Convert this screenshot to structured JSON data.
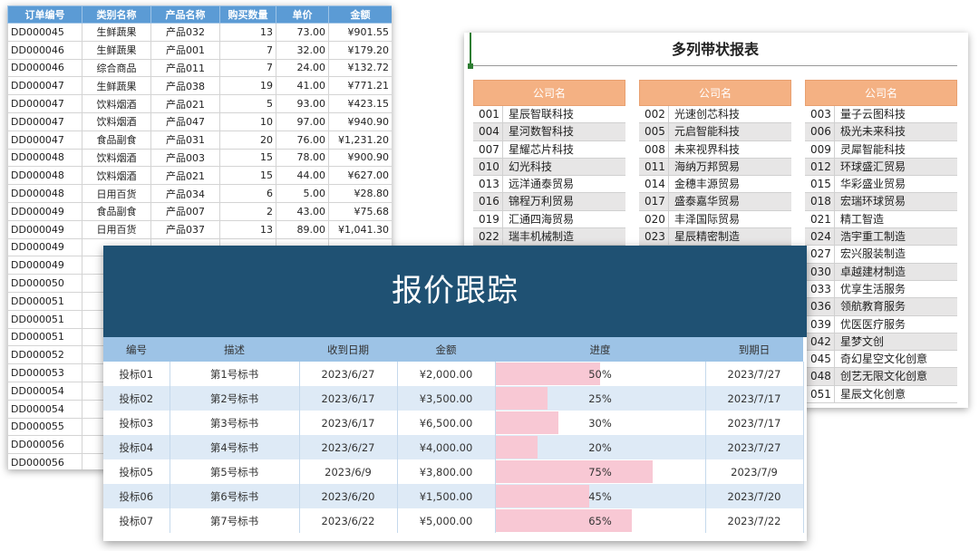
{
  "orders_sheet": {
    "headers": [
      "订单编号",
      "类别名称",
      "产品名称",
      "购买数量",
      "单价",
      "金额"
    ],
    "rows": [
      [
        "DD000045",
        "生鲜蔬果",
        "产品032",
        "13",
        "73.00",
        "¥901.55"
      ],
      [
        "DD000046",
        "生鲜蔬果",
        "产品001",
        "7",
        "32.00",
        "¥179.20"
      ],
      [
        "DD000046",
        "综合商品",
        "产品011",
        "7",
        "24.00",
        "¥132.72"
      ],
      [
        "DD000047",
        "生鲜蔬果",
        "产品038",
        "19",
        "41.00",
        "¥771.21"
      ],
      [
        "DD000047",
        "饮料烟酒",
        "产品021",
        "5",
        "93.00",
        "¥423.15"
      ],
      [
        "DD000047",
        "饮料烟酒",
        "产品047",
        "10",
        "97.00",
        "¥940.90"
      ],
      [
        "DD000047",
        "食品副食",
        "产品031",
        "20",
        "76.00",
        "¥1,231.20"
      ],
      [
        "DD000048",
        "饮料烟酒",
        "产品003",
        "15",
        "78.00",
        "¥900.90"
      ],
      [
        "DD000048",
        "饮料烟酒",
        "产品021",
        "15",
        "44.00",
        "¥627.00"
      ],
      [
        "DD000048",
        "日用百货",
        "产品034",
        "6",
        "5.00",
        "¥28.80"
      ],
      [
        "DD000049",
        "食品副食",
        "产品007",
        "2",
        "43.00",
        "¥75.68"
      ],
      [
        "DD000049",
        "日用百货",
        "产品037",
        "13",
        "89.00",
        "¥1,041.30"
      ],
      [
        "DD000049",
        "",
        "",
        "",
        "",
        ""
      ],
      [
        "DD000049",
        "",
        "",
        "",
        "",
        ""
      ],
      [
        "DD000050",
        "",
        "",
        "",
        "",
        ""
      ],
      [
        "DD000051",
        "",
        "",
        "",
        "",
        ""
      ],
      [
        "DD000051",
        "",
        "",
        "",
        "",
        ""
      ],
      [
        "DD000051",
        "",
        "",
        "",
        "",
        ""
      ],
      [
        "DD000052",
        "",
        "",
        "",
        "",
        ""
      ],
      [
        "DD000053",
        "",
        "",
        "",
        "",
        ""
      ],
      [
        "DD000054",
        "",
        "",
        "",
        "",
        ""
      ],
      [
        "DD000054",
        "",
        "",
        "",
        "",
        ""
      ],
      [
        "DD000055",
        "",
        "",
        "",
        "",
        ""
      ],
      [
        "DD000056",
        "",
        "",
        "",
        "",
        ""
      ],
      [
        "DD000056",
        "",
        "",
        "",
        "",
        ""
      ]
    ]
  },
  "banded_sheet": {
    "title": "多列带状报表",
    "column_header": "公司名",
    "columns": [
      [
        [
          "001",
          "星辰智联科技"
        ],
        [
          "004",
          "星河数智科技"
        ],
        [
          "007",
          "星耀芯片科技"
        ],
        [
          "010",
          "幻光科技"
        ],
        [
          "013",
          "远洋通泰贸易"
        ],
        [
          "016",
          "锦程万利贸易"
        ],
        [
          "019",
          "汇通四海贸易"
        ],
        [
          "022",
          "瑞丰机械制造"
        ]
      ],
      [
        [
          "002",
          "光速创芯科技"
        ],
        [
          "005",
          "元启智能科技"
        ],
        [
          "008",
          "未来视界科技"
        ],
        [
          "011",
          "海纳万邦贸易"
        ],
        [
          "014",
          "金穗丰源贸易"
        ],
        [
          "017",
          "盛泰嘉华贸易"
        ],
        [
          "020",
          "丰泽国际贸易"
        ],
        [
          "023",
          "星辰精密制造"
        ]
      ],
      [
        [
          "003",
          "量子云图科技"
        ],
        [
          "006",
          "极光未来科技"
        ],
        [
          "009",
          "灵犀智能科技"
        ],
        [
          "012",
          "环球盛汇贸易"
        ],
        [
          "015",
          "华彩盛业贸易"
        ],
        [
          "018",
          "宏瑞环球贸易"
        ],
        [
          "021",
          "精工智造"
        ],
        [
          "024",
          "浩宇重工制造"
        ],
        [
          "027",
          "宏兴服装制造"
        ],
        [
          "030",
          "卓越建材制造"
        ],
        [
          "033",
          "优享生活服务"
        ],
        [
          "036",
          "领航教育服务"
        ],
        [
          "039",
          "优医医疗服务"
        ],
        [
          "042",
          "星梦文创"
        ],
        [
          "045",
          "奇幻星空文化创意"
        ],
        [
          "048",
          "创艺无限文化创意"
        ],
        [
          "051",
          "星辰文化创意"
        ]
      ]
    ]
  },
  "tracker_sheet": {
    "title": "报价跟踪",
    "headers": [
      "编号",
      "描述",
      "收到日期",
      "金额",
      "进度",
      "到期日"
    ],
    "rows": [
      {
        "id": "投标01",
        "desc": "第1号标书",
        "received": "2023/6/27",
        "amount": "¥2,000.00",
        "progress": 0.5,
        "progress_label": "50%",
        "due": "2023/7/27"
      },
      {
        "id": "投标02",
        "desc": "第2号标书",
        "received": "2023/6/17",
        "amount": "¥3,500.00",
        "progress": 0.25,
        "progress_label": "25%",
        "due": "2023/7/17"
      },
      {
        "id": "投标03",
        "desc": "第3号标书",
        "received": "2023/6/17",
        "amount": "¥6,500.00",
        "progress": 0.3,
        "progress_label": "30%",
        "due": "2023/7/17"
      },
      {
        "id": "投标04",
        "desc": "第4号标书",
        "received": "2023/6/27",
        "amount": "¥4,000.00",
        "progress": 0.2,
        "progress_label": "20%",
        "due": "2023/7/27"
      },
      {
        "id": "投标05",
        "desc": "第5号标书",
        "received": "2023/6/9",
        "amount": "¥3,800.00",
        "progress": 0.75,
        "progress_label": "75%",
        "due": "2023/7/9"
      },
      {
        "id": "投标06",
        "desc": "第6号标书",
        "received": "2023/6/20",
        "amount": "¥1,500.00",
        "progress": 0.45,
        "progress_label": "45%",
        "due": "2023/7/20"
      },
      {
        "id": "投标07",
        "desc": "第7号标书",
        "received": "2023/6/22",
        "amount": "¥5,000.00",
        "progress": 0.65,
        "progress_label": "65%",
        "due": "2023/7/22"
      }
    ]
  },
  "colors": {
    "orders_header": "#5b9bd5",
    "band_header": "#f4b183",
    "band_stripe": "#e7e6e6",
    "tracker_banner": "#1f5173",
    "tracker_header": "#9dc3e6",
    "tracker_alt_row": "#deeaf6",
    "progress_bar": "#f8c8d4"
  }
}
